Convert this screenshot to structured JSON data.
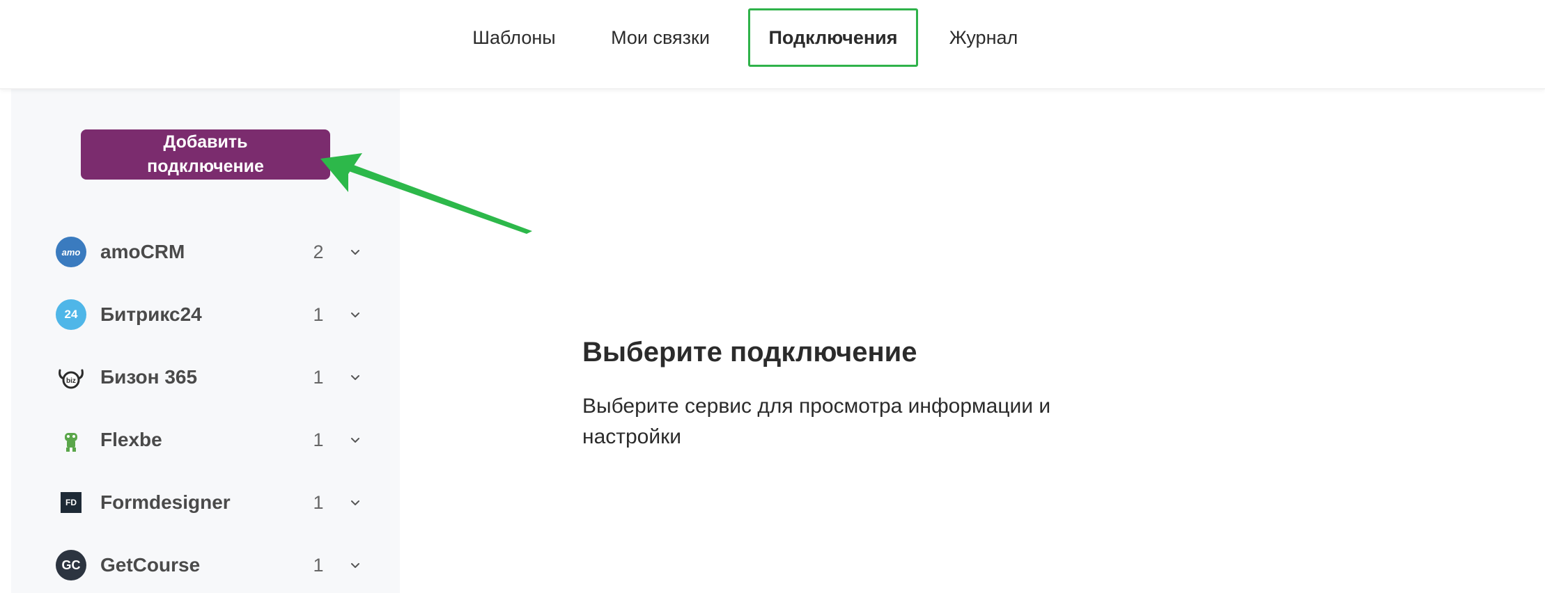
{
  "nav": {
    "tabs": [
      {
        "label": "Шаблоны",
        "active": false
      },
      {
        "label": "Мои связки",
        "active": false
      },
      {
        "label": "Подключения",
        "active": true
      },
      {
        "label": "Журнал",
        "active": false
      }
    ],
    "active_highlight_color": "#2fb24a"
  },
  "sidebar": {
    "add_button_label": "Добавить подключение",
    "add_button_color": "#7b2c6e",
    "services": [
      {
        "name": "amoCRM",
        "count": "2",
        "logo": "amocrm-logo-icon",
        "logo_text": "amo",
        "logo_color": "#3a7bbf"
      },
      {
        "name": "Битрикс24",
        "count": "1",
        "logo": "bitrix24-logo-icon",
        "logo_text": "24",
        "logo_color": "#4fb6e8"
      },
      {
        "name": "Бизон 365",
        "count": "1",
        "logo": "bizon365-logo-icon",
        "logo_text": "biz",
        "logo_color": "#2b2b2b"
      },
      {
        "name": "Flexbe",
        "count": "1",
        "logo": "flexbe-logo-icon",
        "logo_color": "#5aa64a"
      },
      {
        "name": "Formdesigner",
        "count": "1",
        "logo": "formdesigner-logo-icon",
        "logo_text": "FD",
        "logo_color": "#1e2a36"
      },
      {
        "name": "GetCourse",
        "count": "1",
        "logo": "getcourse-logo-icon",
        "logo_text": "GC",
        "logo_color": "#2c3440"
      }
    ]
  },
  "main": {
    "empty_title": "Выберите подключение",
    "empty_description": "Выберите сервис для просмотра информации и настройки"
  },
  "annotation": {
    "arrow_color": "#2db84a",
    "arrow_icon": "green-arrow-icon"
  }
}
